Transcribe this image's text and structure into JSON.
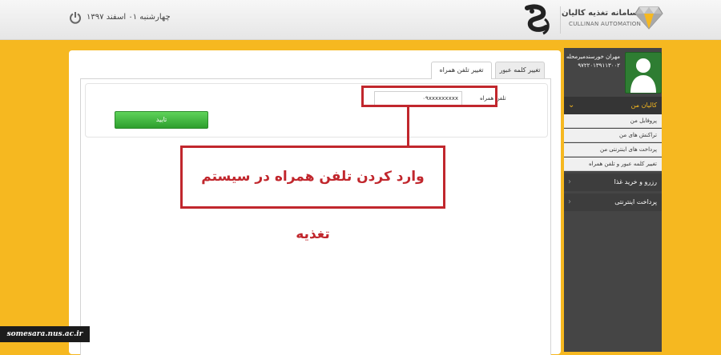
{
  "header": {
    "date_text": "چهارشنبه ۰۱ اسفند ۱۳۹۷",
    "brand_name_fa": "سامانه تغذیه کالیان",
    "brand_name_en": "CULLINAN AUTOMATION"
  },
  "tabs": [
    {
      "label": "تغییر کلمه عبور",
      "active": false
    },
    {
      "label": "تغییر تلفن همراه",
      "active": true
    }
  ],
  "form": {
    "phone_label": "تلفن همراه",
    "phone_value": "۰۹xxxxxxxxx",
    "confirm_label": "تایید"
  },
  "annotation": {
    "callout_text": "وارد کردن تلفن همراه در سیستم تغذیه",
    "color": "#c1272d"
  },
  "sidebar": {
    "user_name": "مهران خورسندمیرمحله",
    "user_id": "۹۷۲۲۰۱۳۹۱۱۳۰۰۲",
    "menu_kalian": "کالیان من",
    "submenu": [
      "پروفایل من",
      "تراکنش های من",
      "پرداخت های اینترنتی من",
      "تغییر کلمه عبور و تلفن همراه"
    ],
    "menu_reserve": "رزرو و خرید غذا",
    "menu_payment": "پرداخت اینترنتی"
  },
  "watermark": "somesara.nus.ac.ir",
  "colors": {
    "background": "#f6b820",
    "sidebar": "#454545",
    "button_green": "#3cb83a",
    "accent_red": "#c1272d"
  }
}
